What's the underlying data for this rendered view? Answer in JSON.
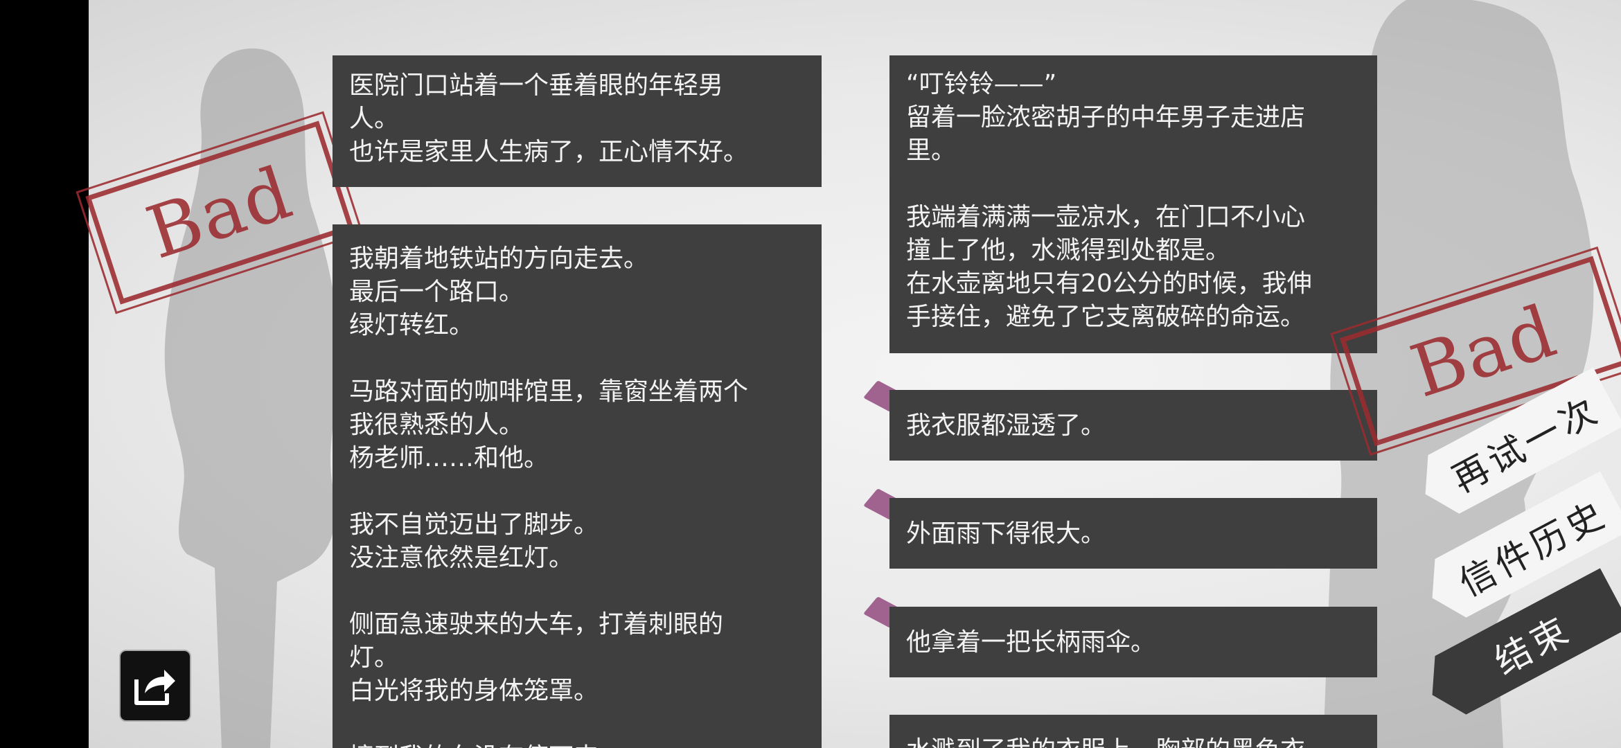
{
  "stamps": {
    "left": "Bad",
    "right": "Bad"
  },
  "left_column": {
    "panel1": "医院门口站着一个垂着眼的年轻男\n人。\n也许是家里人生病了，正心情不好。",
    "panel2": "我朝着地铁站的方向走去。\n最后一个路口。\n绿灯转红。\n\n马路对面的咖啡馆里，靠窗坐着两个\n我很熟悉的人。\n杨老师……和他。\n\n我不自觉迈出了脚步。\n没注意依然是红灯。\n\n侧面急速驶来的大车，打着刺眼的\n灯。\n白光将我的身体笼罩。\n\n撞到我的车没有停下来。"
  },
  "right_column": {
    "panel1": "“叮铃铃——”\n留着一脸浓密胡子的中年男子走进店\n里。\n\n我端着满满一壶凉水，在门口不小心\n撞上了他，水溅得到处都是。\n在水壶离地只有20公分的时候，我伸\n手接住，避免了它支离破碎的命运。",
    "choices": [
      "我衣服都湿透了。",
      "外面雨下得很大。",
      "他拿着一把长柄雨伞。"
    ],
    "panel_last": "水溅到了我的衣服上，胸部的黑色衣"
  },
  "menu": {
    "retry": "再试一次",
    "letters": "信件历史",
    "end": "结束"
  },
  "icons": {
    "share": "share-icon",
    "choice_marker": "choice-marker-icon"
  },
  "colors": {
    "panel": "#3f3f3f",
    "stamp": "#9c2b30",
    "marker": "#a0628f"
  }
}
